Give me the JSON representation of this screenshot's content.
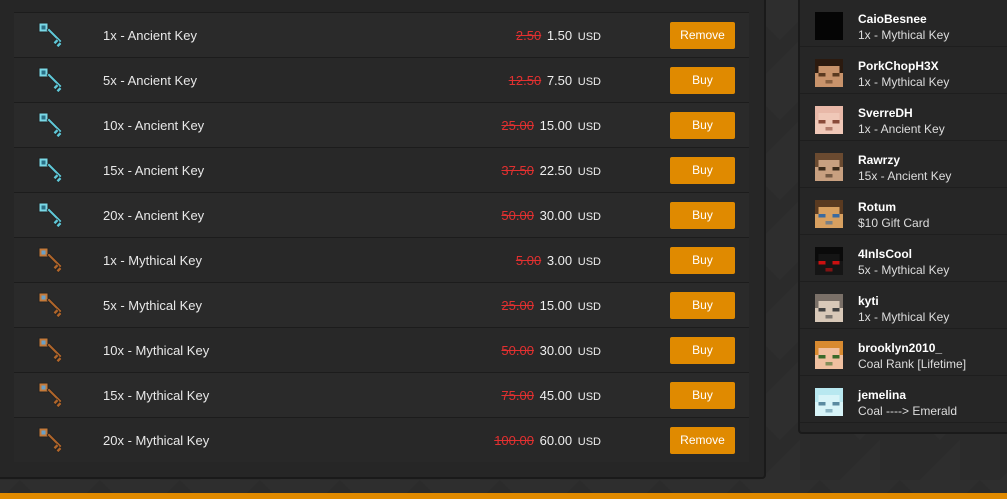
{
  "colors": {
    "accent": "#e08a00",
    "strike": "#e23030",
    "panel": "#262626"
  },
  "packages": [
    {
      "name": "1x - Ancient Key",
      "old": "2.50",
      "price": "1.50",
      "currency": "USD",
      "button": "Remove",
      "icon": "ancient-key-icon"
    },
    {
      "name": "5x - Ancient Key",
      "old": "12.50",
      "price": "7.50",
      "currency": "USD",
      "button": "Buy",
      "icon": "ancient-key-icon"
    },
    {
      "name": "10x - Ancient Key",
      "old": "25.00",
      "price": "15.00",
      "currency": "USD",
      "button": "Buy",
      "icon": "ancient-key-icon"
    },
    {
      "name": "15x - Ancient Key",
      "old": "37.50",
      "price": "22.50",
      "currency": "USD",
      "button": "Buy",
      "icon": "ancient-key-icon"
    },
    {
      "name": "20x - Ancient Key",
      "old": "50.00",
      "price": "30.00",
      "currency": "USD",
      "button": "Buy",
      "icon": "ancient-key-icon"
    },
    {
      "name": "1x - Mythical Key",
      "old": "5.00",
      "price": "3.00",
      "currency": "USD",
      "button": "Buy",
      "icon": "mythical-key-icon"
    },
    {
      "name": "5x - Mythical Key",
      "old": "25.00",
      "price": "15.00",
      "currency": "USD",
      "button": "Buy",
      "icon": "mythical-key-icon"
    },
    {
      "name": "10x - Mythical Key",
      "old": "50.00",
      "price": "30.00",
      "currency": "USD",
      "button": "Buy",
      "icon": "mythical-key-icon"
    },
    {
      "name": "15x - Mythical Key",
      "old": "75.00",
      "price": "45.00",
      "currency": "USD",
      "button": "Buy",
      "icon": "mythical-key-icon"
    },
    {
      "name": "20x - Mythical Key",
      "old": "100.00",
      "price": "60.00",
      "currency": "USD",
      "button": "Remove",
      "icon": "mythical-key-icon"
    }
  ],
  "recent_payments": [
    {
      "player": "CaioBesnee",
      "item": "1x - Mythical Key",
      "avatar": "black"
    },
    {
      "player": "PorkChopH3X",
      "item": "1x - Mythical Key",
      "avatar": "steve"
    },
    {
      "player": "SverreDH",
      "item": "1x - Ancient Key",
      "avatar": "pig"
    },
    {
      "player": "Rawrzy",
      "item": "15x - Ancient Key",
      "avatar": "brown"
    },
    {
      "player": "Rotum",
      "item": "$10 Gift Card",
      "avatar": "villager"
    },
    {
      "player": "4InlsCool",
      "item": "5x - Mythical Key",
      "avatar": "dark-red-eyes"
    },
    {
      "player": "kyti",
      "item": "1x - Mythical Key",
      "avatar": "grey"
    },
    {
      "player": "brooklyn2010_",
      "item": "Coal Rank [Lifetime]",
      "avatar": "orange-hair"
    },
    {
      "player": "jemelina",
      "item": "Coal ----> Emerald",
      "avatar": "cyan"
    }
  ]
}
